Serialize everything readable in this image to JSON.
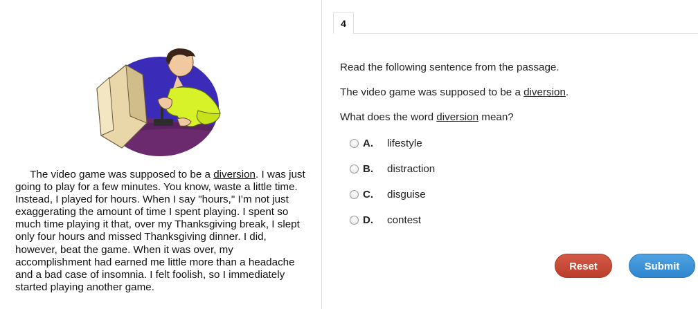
{
  "passage": {
    "before_word": "The video game was supposed to be a ",
    "underlined_word": "diversion",
    "after_word": ". I was just going to play for a few minutes. You know, waste a little time. Instead, I played for hours. When I say \"hours,\" I’m not just exaggerating the amount of time I spent playing. I spent so much time playing it that, over my Thanksgiving break, I slept only four hours and missed Thanksgiving dinner. I did, however, beat the game. When it was over, my accomplishment had earned me little more than a headache and a bad case of insomnia. I felt foolish, so I immediately started playing another game."
  },
  "question": {
    "number": "4",
    "prompt_1": "Read the following sentence from the passage.",
    "prompt_2_before": "The video game was supposed to be a ",
    "prompt_2_word": "diversion",
    "prompt_2_after": ".",
    "prompt_3_before": "What does the word ",
    "prompt_3_word": "diversion",
    "prompt_3_after": " mean?",
    "choices": [
      {
        "letter": "A.",
        "text": "lifestyle"
      },
      {
        "letter": "B.",
        "text": "distraction"
      },
      {
        "letter": "C.",
        "text": "disguise"
      },
      {
        "letter": "D.",
        "text": "contest"
      }
    ]
  },
  "buttons": {
    "reset_label": "Reset",
    "submit_label": "Submit"
  },
  "colors": {
    "reset": "#c44a36",
    "submit": "#3b93da",
    "illustration_background": "#3a2bb8",
    "shirt": "#d8f22a"
  },
  "icons": {
    "illustration": "person-playing-video-game"
  }
}
